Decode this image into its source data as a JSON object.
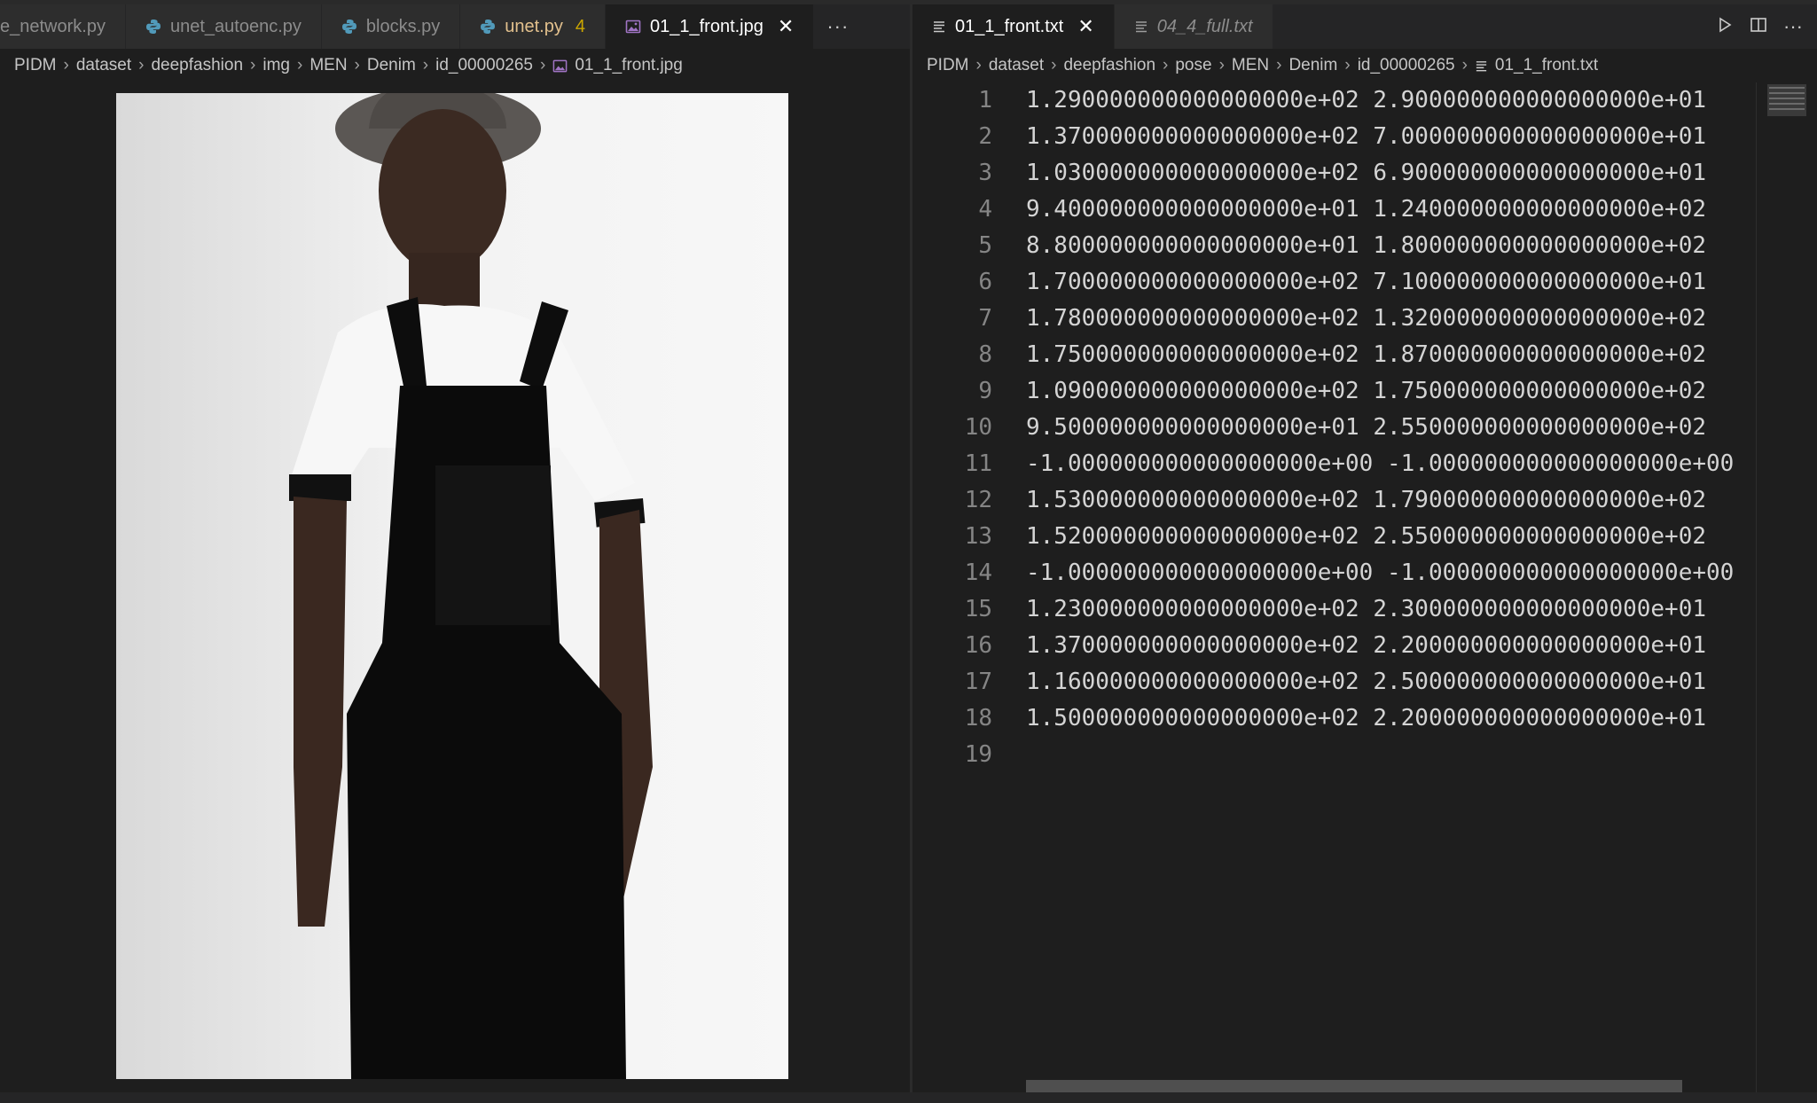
{
  "left": {
    "tabs": [
      {
        "label": "e_network.py",
        "icon": "python-icon",
        "state": "inactive"
      },
      {
        "label": "unet_autoenc.py",
        "icon": "python-icon",
        "state": "inactive"
      },
      {
        "label": "blocks.py",
        "icon": "python-icon",
        "state": "inactive"
      },
      {
        "label": "unet.py",
        "icon": "python-icon",
        "state": "modified",
        "badge": "4"
      },
      {
        "label": "01_1_front.jpg",
        "icon": "image-icon",
        "state": "active"
      }
    ],
    "more_label": "···",
    "breadcrumb": [
      "PIDM",
      "dataset",
      "deepfashion",
      "img",
      "MEN",
      "Denim",
      "id_00000265",
      "01_1_front.jpg"
    ]
  },
  "right": {
    "tabs": [
      {
        "label": "01_1_front.txt",
        "icon": "file-text-icon",
        "state": "active"
      },
      {
        "label": "04_4_full.txt",
        "icon": "file-text-icon",
        "state": "preview"
      }
    ],
    "breadcrumb": [
      "PIDM",
      "dataset",
      "deepfashion",
      "pose",
      "MEN",
      "Denim",
      "id_00000265",
      "01_1_front.txt"
    ],
    "line_numbers": [
      "1",
      "2",
      "3",
      "4",
      "5",
      "6",
      "7",
      "8",
      "9",
      "10",
      "11",
      "12",
      "13",
      "14",
      "15",
      "16",
      "17",
      "18",
      "19"
    ],
    "lines": [
      "1.290000000000000000e+02 2.900000000000000000e+01",
      "1.370000000000000000e+02 7.000000000000000000e+01",
      "1.030000000000000000e+02 6.900000000000000000e+01",
      "9.400000000000000000e+01 1.240000000000000000e+02",
      "8.800000000000000000e+01 1.800000000000000000e+02",
      "1.700000000000000000e+02 7.100000000000000000e+01",
      "1.780000000000000000e+02 1.320000000000000000e+02",
      "1.750000000000000000e+02 1.870000000000000000e+02",
      "1.090000000000000000e+02 1.750000000000000000e+02",
      "9.500000000000000000e+01 2.550000000000000000e+02",
      "-1.000000000000000000e+00 -1.000000000000000000e+00",
      "1.530000000000000000e+02 1.790000000000000000e+02",
      "1.520000000000000000e+02 2.550000000000000000e+02",
      "-1.000000000000000000e+00 -1.000000000000000000e+00",
      "1.230000000000000000e+02 2.300000000000000000e+01",
      "1.370000000000000000e+02 2.200000000000000000e+01",
      "1.160000000000000000e+02 2.500000000000000000e+01",
      "1.500000000000000000e+02 2.200000000000000000e+01",
      ""
    ]
  },
  "colors": {
    "editor_bg": "#1e1e1e",
    "tab_inactive_bg": "#2d2d2d",
    "python_icon": "#519aba",
    "image_icon": "#a074c4",
    "modified": "#e2c08d",
    "badge": "#cca700"
  }
}
